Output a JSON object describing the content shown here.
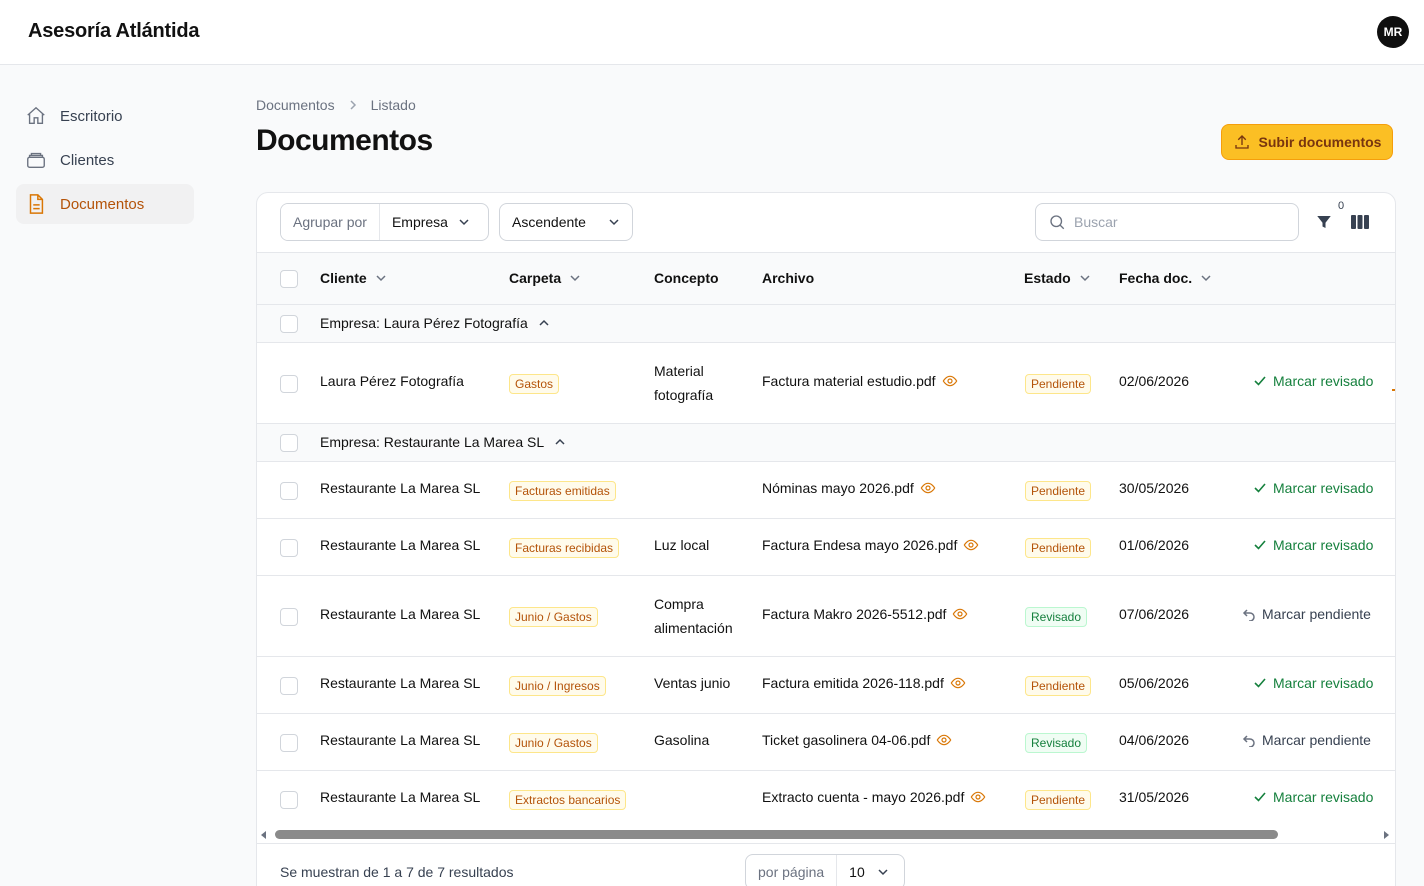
{
  "app": {
    "brand": "Asesoría Atlántida",
    "user_initials": "MR"
  },
  "sidebar": {
    "items": [
      {
        "label": "Escritorio",
        "icon": "home-icon",
        "active": false
      },
      {
        "label": "Clientes",
        "icon": "clients-icon",
        "active": false
      },
      {
        "label": "Documentos",
        "icon": "document-icon",
        "active": true
      }
    ]
  },
  "breadcrumb": {
    "items": [
      "Documentos",
      "Listado"
    ]
  },
  "page": {
    "title": "Documentos",
    "upload_label": "Subir documentos"
  },
  "toolbar": {
    "group_prefix": "Agrupar por",
    "group_value": "Empresa",
    "order_value": "Ascendente",
    "search_placeholder": "Buscar",
    "filter_count": "0"
  },
  "table": {
    "headers": {
      "client": "Cliente",
      "folder": "Carpeta",
      "concept": "Concepto",
      "file": "Archivo",
      "status": "Estado",
      "date": "Fecha doc."
    },
    "groups": [
      {
        "label": "Empresa: Laura Pérez Fotografía",
        "rows": [
          {
            "client": "Laura Pérez Fotografía",
            "folder": "Gastos",
            "concept": "Material fotografía",
            "file": "Factura material estudio.pdf",
            "status": "Pendiente",
            "date": "02/06/2026",
            "action": "Marcar revisado"
          }
        ]
      },
      {
        "label": "Empresa: Restaurante La Marea SL",
        "rows": [
          {
            "client": "Restaurante La Marea SL",
            "folder": "Facturas emitidas",
            "concept": "",
            "file": "Nóminas mayo 2026.pdf",
            "status": "Pendiente",
            "date": "30/05/2026",
            "action": "Marcar revisado"
          },
          {
            "client": "Restaurante La Marea SL",
            "folder": "Facturas recibidas",
            "concept": "Luz local",
            "file": "Factura Endesa mayo 2026.pdf",
            "status": "Pendiente",
            "date": "01/06/2026",
            "action": "Marcar revisado"
          },
          {
            "client": "Restaurante La Marea SL",
            "folder": "Junio / Gastos",
            "concept": "Compra alimentación",
            "file": "Factura Makro 2026-5512.pdf",
            "status": "Revisado",
            "date": "07/06/2026",
            "action": "Marcar pendiente"
          },
          {
            "client": "Restaurante La Marea SL",
            "folder": "Junio / Ingresos",
            "concept": "Ventas junio",
            "file": "Factura emitida 2026-118.pdf",
            "status": "Pendiente",
            "date": "05/06/2026",
            "action": "Marcar revisado"
          },
          {
            "client": "Restaurante La Marea SL",
            "folder": "Junio / Gastos",
            "concept": "Gasolina",
            "file": "Ticket gasolinera 04-06.pdf",
            "status": "Revisado",
            "date": "04/06/2026",
            "action": "Marcar pendiente"
          },
          {
            "client": "Restaurante La Marea SL",
            "folder": "Extractos bancarios",
            "concept": "",
            "file": "Extracto cuenta - mayo 2026.pdf",
            "status": "Pendiente",
            "date": "31/05/2026",
            "action": "Marcar revisado"
          }
        ]
      }
    ]
  },
  "footer": {
    "results_text": "Se muestran de 1 a 7 de 7 resultados",
    "perpage_prefix": "por página",
    "perpage_value": "10"
  },
  "colors": {
    "accent": "#fbbf24",
    "accent_text": "#b45309",
    "success": "#15803d"
  }
}
